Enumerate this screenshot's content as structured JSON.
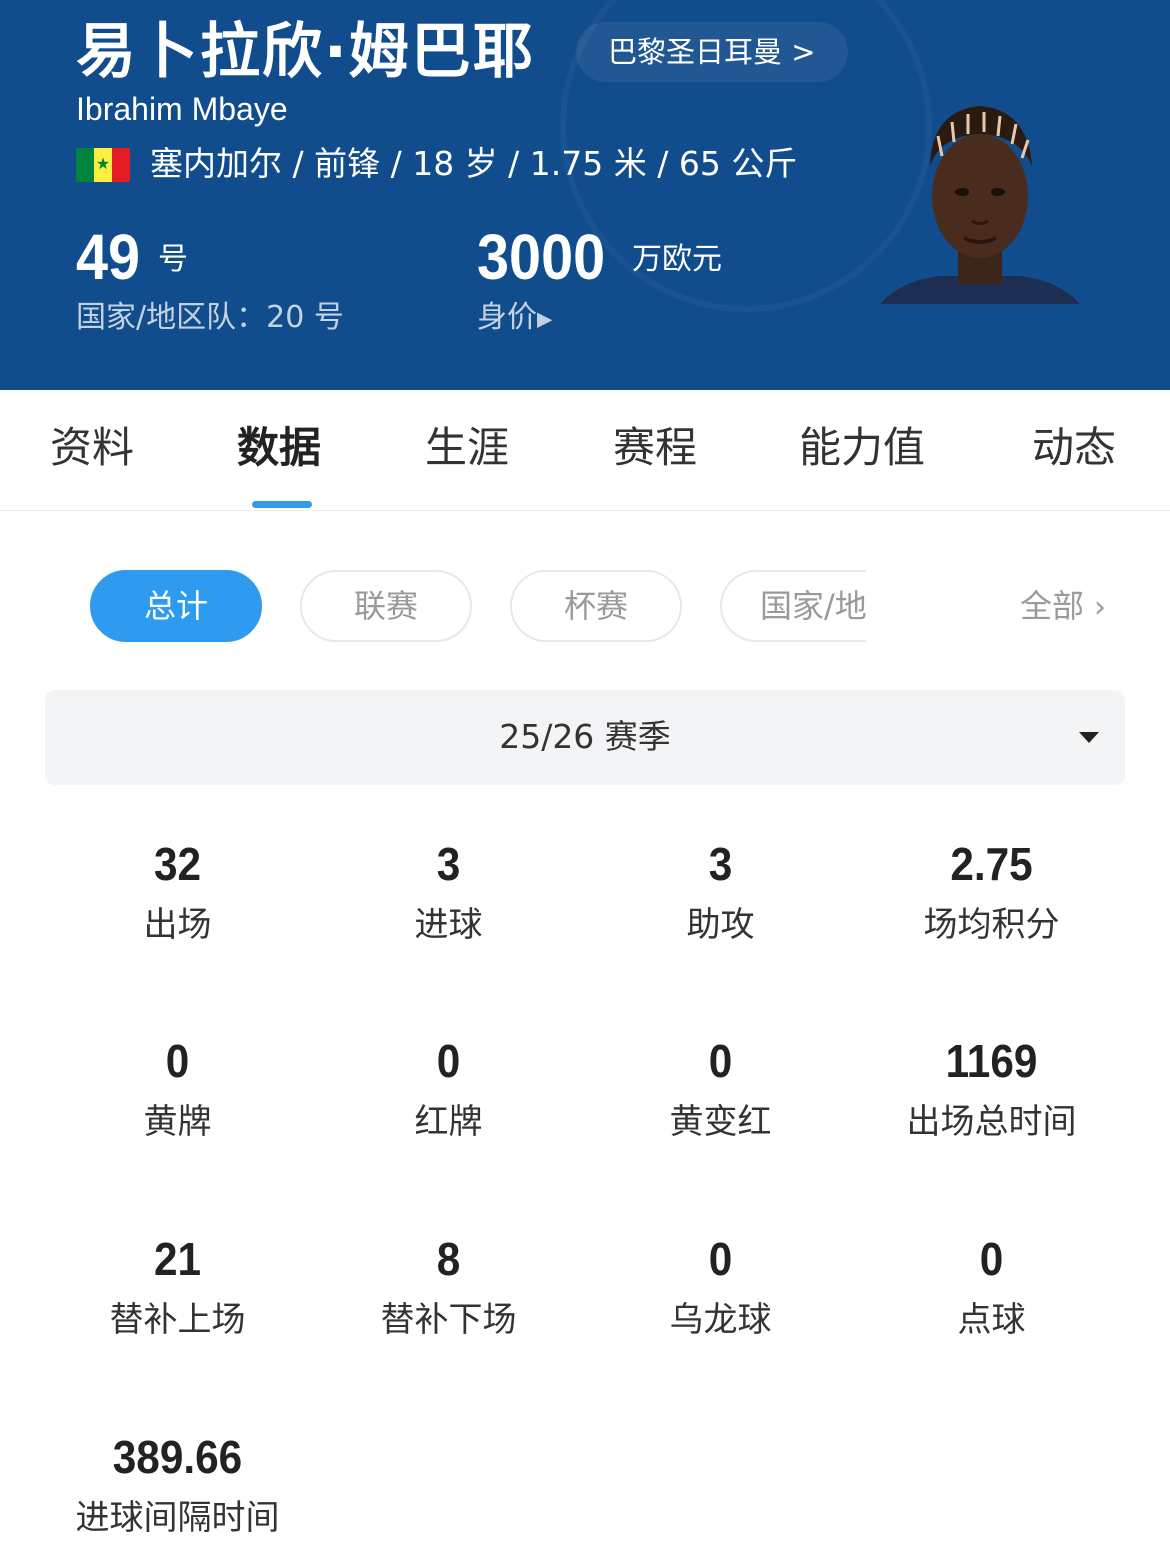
{
  "header": {
    "player_name_cn": "易卜拉欣·姆巴耶",
    "player_name_en": "Ibrahim Mbaye",
    "club_link": "巴黎圣日耳曼 >",
    "flag_icon": "senegal-flag-icon",
    "info": "塞内加尔 / 前锋 / 18 岁 / 1.75 米 / 65 公斤",
    "shirt_number": "49",
    "shirt_number_unit": "号",
    "national_team": "国家/地区队：20 号",
    "market_value": "3000",
    "market_value_unit": "万欧元",
    "market_value_label": "身价",
    "bg_color": "#114c8c"
  },
  "tabs": [
    {
      "label": "资料"
    },
    {
      "label": "数据",
      "active": true
    },
    {
      "label": "生涯"
    },
    {
      "label": "赛程"
    },
    {
      "label": "能力值"
    },
    {
      "label": "动态"
    }
  ],
  "filters": {
    "items": [
      {
        "label": "总计",
        "active": true
      },
      {
        "label": "联赛"
      },
      {
        "label": "杯赛"
      },
      {
        "label": "国家/地"
      }
    ],
    "all_label": "全部",
    "accent_color": "#2e9bf0"
  },
  "season": {
    "selected": "25/26 赛季"
  },
  "stats": [
    {
      "value": "32",
      "label": "出场"
    },
    {
      "value": "3",
      "label": "进球"
    },
    {
      "value": "3",
      "label": "助攻"
    },
    {
      "value": "2.75",
      "label": "场均积分"
    },
    {
      "value": "0",
      "label": "黄牌"
    },
    {
      "value": "0",
      "label": "红牌"
    },
    {
      "value": "0",
      "label": "黄变红"
    },
    {
      "value": "1169",
      "label": "出场总时间"
    },
    {
      "value": "21",
      "label": "替补上场"
    },
    {
      "value": "8",
      "label": "替补下场"
    },
    {
      "value": "0",
      "label": "乌龙球"
    },
    {
      "value": "0",
      "label": "点球"
    },
    {
      "value": "389.66",
      "label": "进球间隔时间"
    }
  ]
}
